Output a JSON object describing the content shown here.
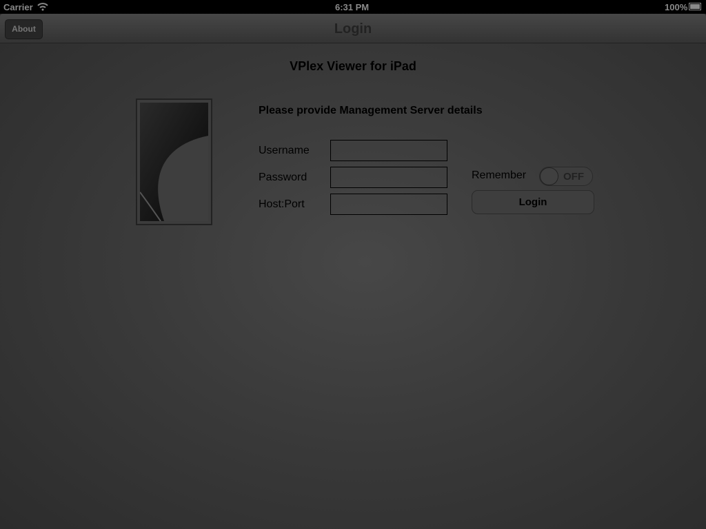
{
  "status_bar": {
    "carrier": "Carrier",
    "time": "6:31 PM",
    "battery": "100%"
  },
  "navbar": {
    "about_label": "About",
    "title": "Login"
  },
  "main": {
    "app_title": "VPlex Viewer for iPad",
    "subtitle": "Please provide Management Server details",
    "username_label": "Username",
    "username_value": "",
    "password_label": "Password",
    "password_value": "",
    "hostport_label": "Host:Port",
    "hostport_value": "",
    "remember_label": "Remember",
    "remember_state": "OFF",
    "login_label": "Login"
  }
}
